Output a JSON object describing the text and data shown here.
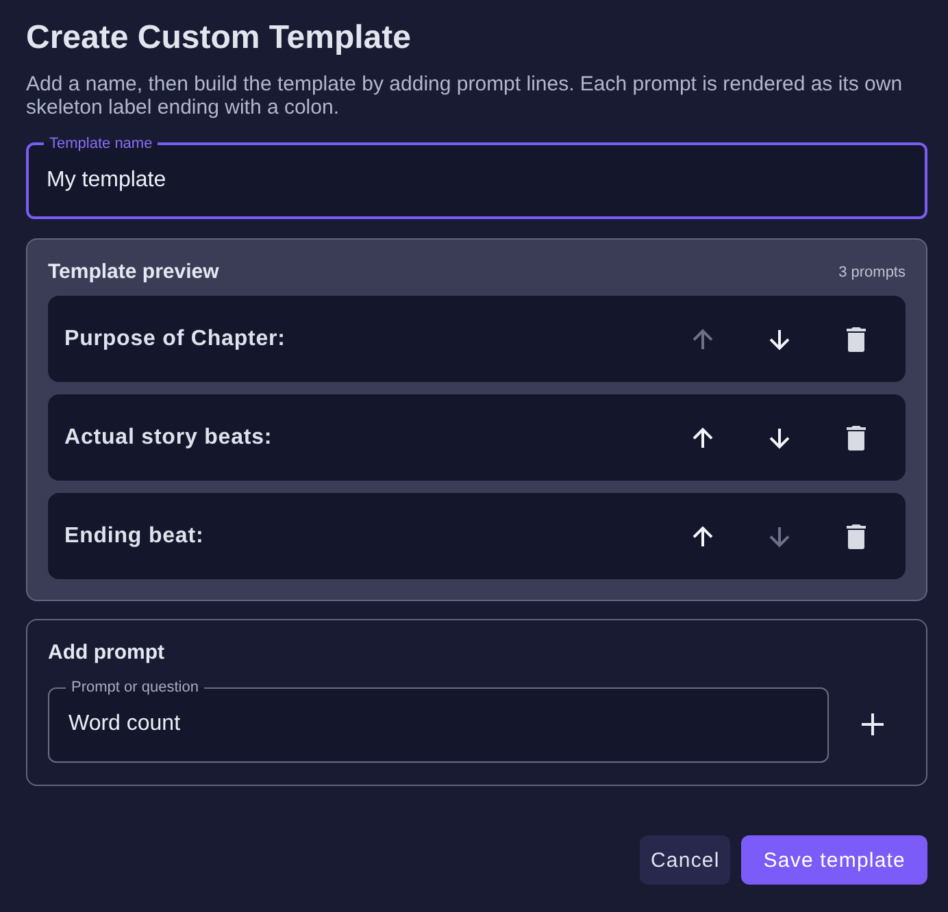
{
  "dialog": {
    "title": "Create Custom Template",
    "description": "Add a name, then build the template by adding prompt lines. Each prompt is rendered as its own skeleton label ending with a colon."
  },
  "name_field": {
    "label": "Template name",
    "value": "My template",
    "focused": true
  },
  "preview": {
    "title": "Template preview",
    "count": "3 prompts",
    "prompts": [
      {
        "label": "Purpose of Chapter:",
        "move_up_disabled": true,
        "move_down_disabled": false
      },
      {
        "label": "Actual story beats:",
        "move_up_disabled": false,
        "move_down_disabled": false
      },
      {
        "label": "Ending beat:",
        "move_up_disabled": false,
        "move_down_disabled": true
      }
    ]
  },
  "add_prompt": {
    "title": "Add prompt",
    "field": {
      "label": "Prompt or question",
      "value": "Word count",
      "focused": false
    }
  },
  "buttons": [
    {
      "label": "Cancel",
      "kind": "secondary"
    },
    {
      "label": "Save template",
      "kind": "primary"
    }
  ]
}
